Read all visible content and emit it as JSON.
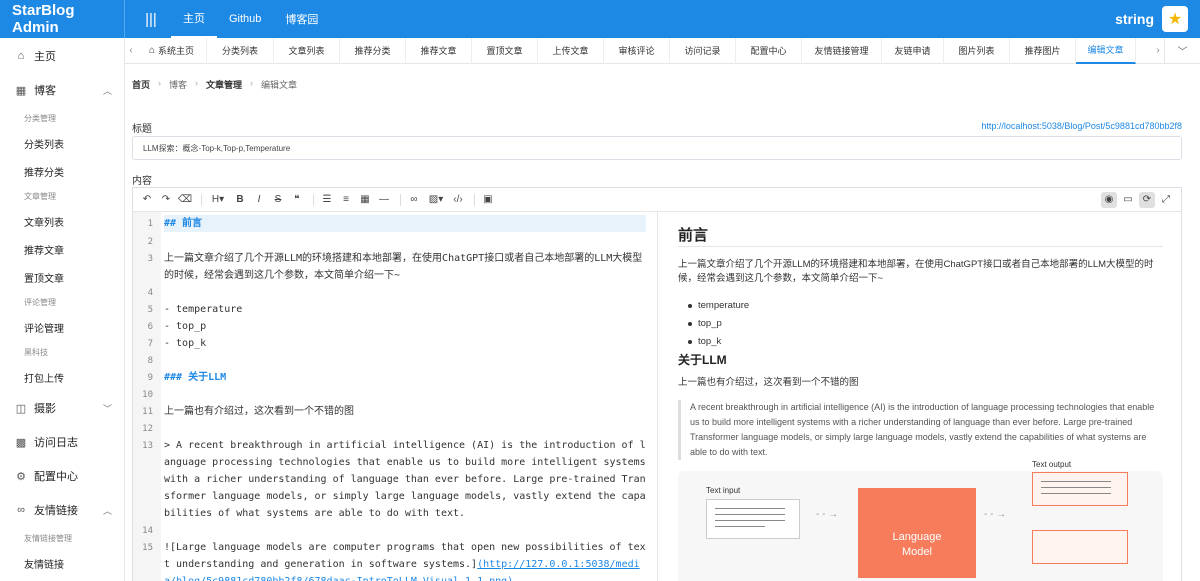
{
  "app": {
    "title": "StarBlog Admin",
    "menu_glyph": "|||",
    "user": "string"
  },
  "topnav": [
    "主页",
    "Github",
    "博客园"
  ],
  "sidebar": {
    "home": "主页",
    "blog": "博客",
    "blog_groups": [
      {
        "group": "分类管理",
        "items": [
          "分类列表",
          "推荐分类"
        ]
      },
      {
        "group": "文章管理",
        "items": [
          "文章列表",
          "推荐文章",
          "置顶文章"
        ]
      },
      {
        "group": "评论管理",
        "items": [
          "评论管理"
        ]
      },
      {
        "group": "黑科技",
        "items": [
          "打包上传"
        ]
      }
    ],
    "photo": "摄影",
    "visit_log": "访问日志",
    "config": "配置中心",
    "links": "友情链接",
    "links_group": "友情链接管理",
    "links_item": "友情链接"
  },
  "tabs": [
    "系统主页",
    "分类列表",
    "文章列表",
    "推荐分类",
    "推荐文章",
    "置顶文章",
    "上传文章",
    "审核评论",
    "访问记录",
    "配置中心",
    "友情链接管理",
    "友链申请",
    "图片列表",
    "推荐图片",
    "编辑文章"
  ],
  "breadcrumb": [
    "首页",
    "博客",
    "文章管理",
    "编辑文章"
  ],
  "form": {
    "title_label": "标题",
    "url": "http://localhost:5038/Blog/Post/5c9881cd780bb2f8",
    "title_value": "LLM探索：概念-Top-k,Top-p,Temperature",
    "content_label": "内容"
  },
  "editor": {
    "lines": [
      {
        "n": "1",
        "t": "## 前言"
      },
      {
        "n": "2",
        "t": ""
      },
      {
        "n": "3",
        "t": "上一篇文章介绍了几个开源LLM的环境搭建和本地部署，在使用ChatGPT接口或者自己本地部署的LLM大模型的时候，经常会遇到这几个参数，本文简单介绍一下~"
      },
      {
        "n": "4",
        "t": ""
      },
      {
        "n": "5",
        "t": "- temperature"
      },
      {
        "n": "6",
        "t": "- top_p"
      },
      {
        "n": "7",
        "t": "- top_k"
      },
      {
        "n": "8",
        "t": ""
      },
      {
        "n": "9",
        "t": "### 关于LLM"
      },
      {
        "n": "10",
        "t": ""
      },
      {
        "n": "11",
        "t": "上一篇也有介绍过，这次看到一个不错的图"
      },
      {
        "n": "12",
        "t": ""
      },
      {
        "n": "13",
        "t": "> A recent breakthrough in artificial intelligence (AI) is the introduction of language processing technologies that enable us to build more intelligent systems with a richer understanding of language than ever before. Large pre-trained Transformer language models, or simply large language models, vastly extend the capabilities of what systems are able to do with text."
      },
      {
        "n": "14",
        "t": ""
      },
      {
        "n": "15",
        "t": "![Large language models are computer programs that open new possibilities of text understanding and generation in software systems.]"
      }
    ],
    "line15_link": "(http://127.0.0.1:5038/media/blog/5c9881cd780bb2f8/678daac-IntroToLLM_Visual_1_1.png)"
  },
  "preview": {
    "h2": "前言",
    "p1": "上一篇文章介绍了几个开源LLM的环境搭建和本地部署，在使用ChatGPT接口或者自己本地部署的LLM大模型的时候，经常会遇到这几个参数，本文简单介绍一下~",
    "list": [
      "temperature",
      "top_p",
      "top_k"
    ],
    "h3": "关于LLM",
    "p2": "上一篇也有介绍过，这次看到一个不错的图",
    "quote": "A recent breakthrough in artificial intelligence (AI) is the introduction of language processing technologies that enable us to build more intelligent systems with a richer understanding of language than ever before. Large pre-trained Transformer language models, or simply large language models, vastly extend the capabilities of what systems are able to do with text.",
    "image": {
      "text_input": "Text input",
      "text_output": "Text output",
      "model_line1": "Language",
      "model_line2": "Model"
    }
  },
  "colors": {
    "accent": "#1e88e5",
    "model_box": "#f77c5c"
  }
}
